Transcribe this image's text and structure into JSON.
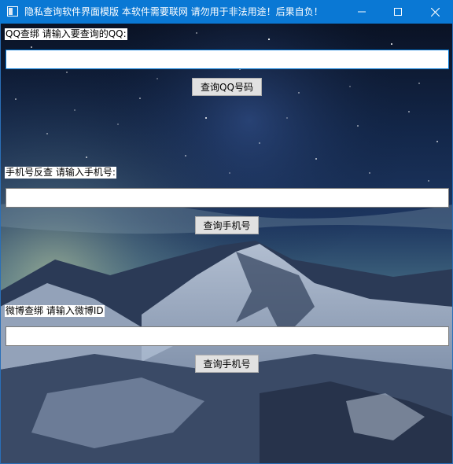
{
  "window": {
    "title": "隐私查询软件界面模版 本软件需要联网 请勿用于非法用途！后果自负！",
    "icon": "app-window-icon",
    "controls": {
      "minimize_icon": "minimize-icon",
      "maximize_icon": "maximize-icon",
      "close_icon": "close-icon"
    },
    "accent_color": "#0a78d4"
  },
  "background": {
    "image": "starry-night-sky-over-snowy-mountains"
  },
  "qq_section": {
    "label": "QQ查绑 请输入要查询的QQ:",
    "input_value": "",
    "button_label": "查询QQ号码"
  },
  "phone_section": {
    "label": "手机号反查 请输入手机号:",
    "input_value": "",
    "button_label": "查询手机号"
  },
  "weibo_section": {
    "label": "微博查绑 请输入微博ID",
    "input_value": "",
    "button_label": "查询手机号"
  }
}
